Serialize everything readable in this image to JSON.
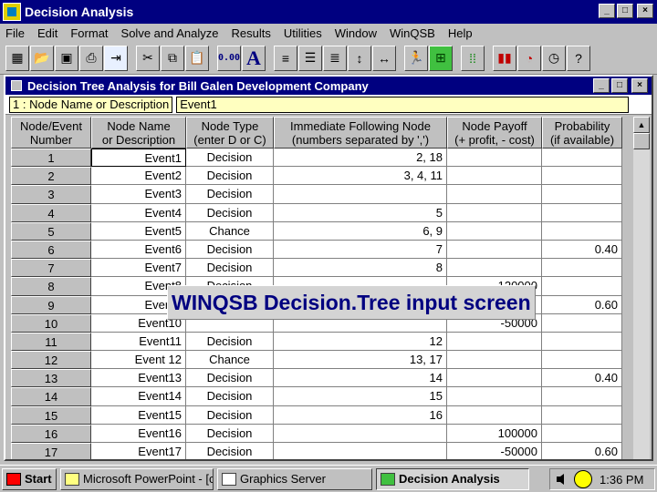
{
  "window": {
    "title": "Decision Analysis",
    "min": "_",
    "max": "□",
    "close": "×"
  },
  "menu": [
    "File",
    "Edit",
    "Format",
    "Solve and Analyze",
    "Results",
    "Utilities",
    "Window",
    "WinQSB",
    "Help"
  ],
  "toolbar": {
    "icons": [
      "grid-icon",
      "open-folder-icon",
      "save-icon",
      "print-icon",
      "exit-door-icon",
      "cut-icon",
      "copy-icon",
      "paste-icon",
      "number-format-icon",
      "font-icon",
      "align-left-icon",
      "align-center-icon",
      "align-right-icon",
      "row-height-icon",
      "column-width-icon",
      "solve-runner-icon",
      "tree-icon",
      "grid-toggle-icon",
      "bar-chart-icon",
      "pie-chart-icon",
      "clock-icon",
      "help-icon"
    ],
    "number_format_label": "0.00",
    "font_label": "A"
  },
  "subwindow": {
    "title": "Decision Tree Analysis for Bill Galen Development Company"
  },
  "editbar": {
    "cell_ref": "1 : Node Name or Description",
    "cell_value": "Event1"
  },
  "table": {
    "headers": [
      [
        "Node/Event",
        "Number"
      ],
      [
        "Node Name",
        "or Description"
      ],
      [
        "Node Type",
        "(enter D or C)"
      ],
      [
        "Immediate Following Node",
        "(numbers separated by ',')"
      ],
      [
        "Node Payoff",
        "(+ profit, - cost)"
      ],
      [
        "Probability",
        "(if available)"
      ]
    ],
    "rows": [
      [
        "1",
        "Event1",
        "Decision",
        "2, 18",
        "",
        ""
      ],
      [
        "2",
        "Event2",
        "Decision",
        "3, 4, 11",
        "",
        ""
      ],
      [
        "3",
        "Event3",
        "Decision",
        "",
        "",
        ""
      ],
      [
        "4",
        "Event4",
        "Decision",
        "5",
        "",
        ""
      ],
      [
        "5",
        "Event5",
        "Chance",
        "6, 9",
        "",
        ""
      ],
      [
        "6",
        "Event6",
        "Decision",
        "7",
        "",
        "0.40"
      ],
      [
        "7",
        "Event7",
        "Decision",
        "8",
        "",
        ""
      ],
      [
        "8",
        "Event8",
        "Decision",
        "",
        "120000",
        ""
      ],
      [
        "9",
        "Event9",
        "",
        "",
        "",
        "0.60"
      ],
      [
        "10",
        "Event10",
        "",
        "",
        "-50000",
        ""
      ],
      [
        "11",
        "Event11",
        "Decision",
        "12",
        "",
        ""
      ],
      [
        "12",
        "Event 12",
        "Chance",
        "13, 17",
        "",
        ""
      ],
      [
        "13",
        "Event13",
        "Decision",
        "14",
        "",
        "0.40"
      ],
      [
        "14",
        "Event14",
        "Decision",
        "15",
        "",
        ""
      ],
      [
        "15",
        "Event15",
        "Decision",
        "16",
        "",
        ""
      ],
      [
        "16",
        "Event16",
        "Decision",
        "",
        "100000",
        ""
      ],
      [
        "17",
        "Event17",
        "Decision",
        "",
        "-50000",
        "0.60"
      ]
    ]
  },
  "overlay": {
    "text": "WINQSB Decision.Tree input screen"
  },
  "taskbar": {
    "start": "Start",
    "buttons": [
      "Microsoft PowerPoint - [c...",
      "Graphics Server",
      "Decision Analysis"
    ],
    "clock": "1:36 PM"
  }
}
